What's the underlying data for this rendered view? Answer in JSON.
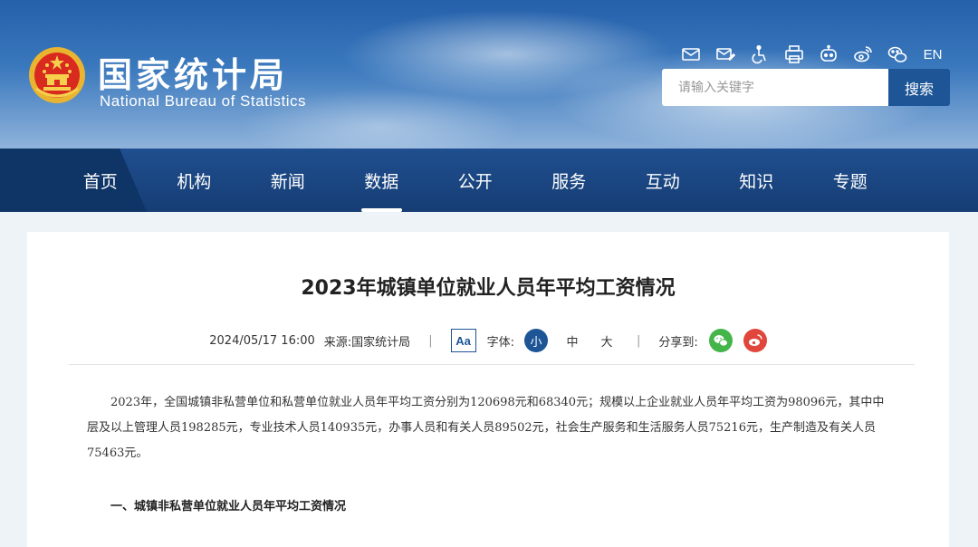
{
  "header": {
    "brand_cn": "国家统计局",
    "brand_en": "National Bureau of Statistics",
    "tools": [
      "mail-icon",
      "mail-edit-icon",
      "accessibility-icon",
      "print-icon",
      "robot-icon",
      "weibo-icon",
      "wechat-icon"
    ],
    "lang_label": "EN",
    "search": {
      "placeholder": "请输入关键字",
      "button_label": "搜索"
    }
  },
  "nav": {
    "items": [
      {
        "label": "首页"
      },
      {
        "label": "机构"
      },
      {
        "label": "新闻"
      },
      {
        "label": "数据"
      },
      {
        "label": "公开"
      },
      {
        "label": "服务"
      },
      {
        "label": "互动"
      },
      {
        "label": "知识"
      },
      {
        "label": "专题"
      }
    ],
    "active_label": "数据"
  },
  "article": {
    "title": "2023年城镇单位就业人员年平均工资情况",
    "date": "2024/05/17 16:00",
    "source_label": "来源:",
    "source": "国家统计局",
    "separator": "|",
    "aa_label": "Aa",
    "font_label": "字体:",
    "font_sizes": [
      "小",
      "中",
      "大"
    ],
    "share_label": "分享到:",
    "paragraph": "2023年，全国城镇非私营单位和私营单位就业人员年平均工资分别为120698元和68340元；规模以上企业就业人员年平均工资为98096元，其中中层及以上管理人员198285元，专业技术人员140935元，办事人员和有关人员89502元，社会生产服务和生活服务人员75216元，生产制造及有关人员75463元。",
    "section_heading": "一、城镇非私营单位就业人员年平均工资情况"
  },
  "colors": {
    "nav_bg": "#1f4f8f",
    "accent": "#1d5596",
    "wechat": "#43b549",
    "weibo": "#e0463b"
  }
}
